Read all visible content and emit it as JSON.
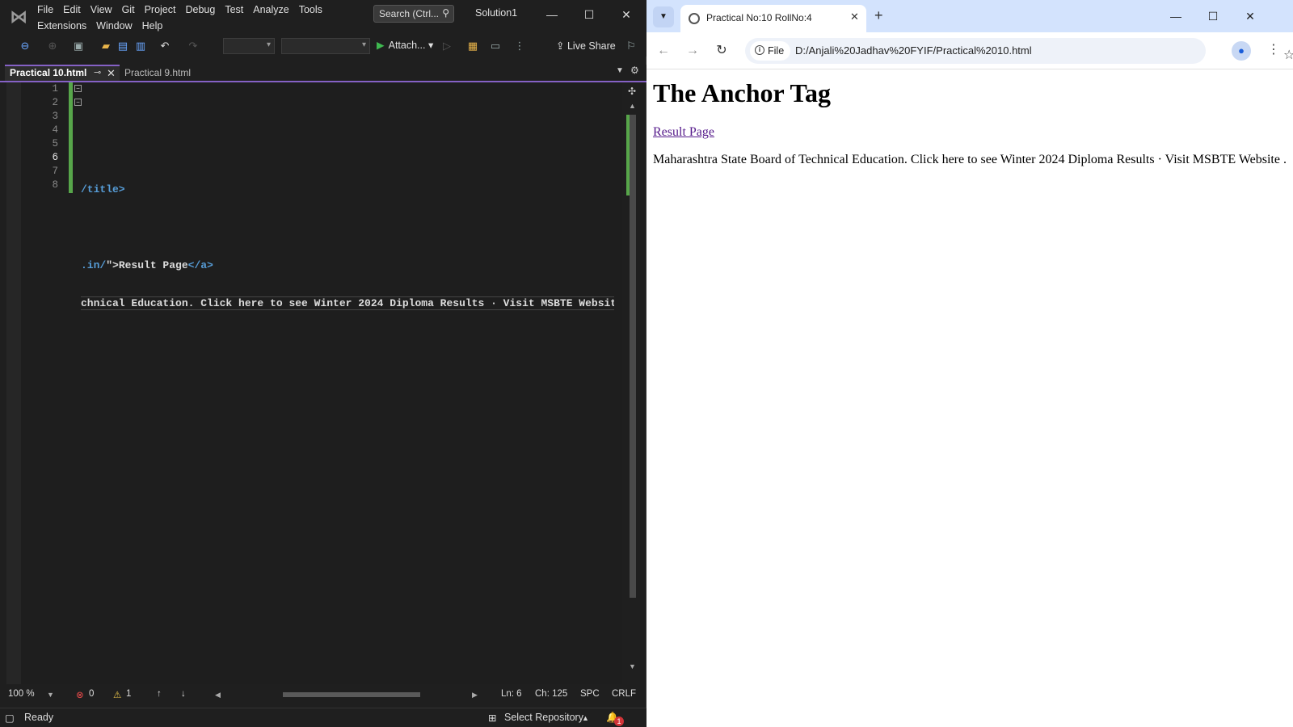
{
  "vs": {
    "menu_row1": [
      "File",
      "Edit",
      "View",
      "Git",
      "Project",
      "Debug",
      "Test",
      "Analyze",
      "Tools"
    ],
    "menu_row2": [
      "Extensions",
      "Window",
      "Help"
    ],
    "search_placeholder": "Search (Ctrl...",
    "solution_name": "Solution1",
    "toolbar": {
      "attach_label": "Attach...",
      "live_share_label": "Live Share"
    },
    "tabs": [
      {
        "label": "Practical 10.html",
        "active": true
      },
      {
        "label": "Practical 9.html",
        "active": false
      }
    ],
    "line_numbers": [
      "1",
      "2",
      "3",
      "4",
      "5",
      "6",
      "7",
      "8"
    ],
    "code_lines": [
      {
        "tag": "",
        "text": ""
      },
      {
        "tag": "",
        "text": ""
      },
      {
        "tag": "/title>",
        "text": ""
      },
      {
        "tag": "",
        "text": ""
      },
      {
        "tag": ".in/",
        "text": "\">Result Page",
        "tag2": "</a>"
      },
      {
        "tag": "",
        "text": "chnical Education. Click here to see Winter 2024 Diploma Results · Visit MSBTE Website ."
      },
      {
        "tag": "",
        "text": ""
      },
      {
        "tag": "",
        "text": ""
      }
    ],
    "status_row": {
      "zoom": "100 %",
      "errors": "0",
      "warnings": "1",
      "line": "Ln: 6",
      "col": "Ch: 125",
      "spacing": "SPC",
      "eol": "CRLF"
    },
    "status_bar": {
      "ready": "Ready",
      "repo": "Select Repository",
      "notifications": "1"
    }
  },
  "chrome": {
    "tab_title": "Practical No:10 RollNo:4",
    "chip_label": "File",
    "url": "D:/Anjali%20Jadhav%20FYIF/Practical%2010.html",
    "page": {
      "heading": "The Anchor Tag",
      "link_text": "Result Page",
      "paragraph": "Maharashtra State Board of Technical Education. Click here to see Winter 2024 Diploma Results · Visit MSBTE Website ."
    }
  },
  "colors": {
    "vs_accent": "#8561c5",
    "change_bar": "#57a64a",
    "html_tag": "#569cd6",
    "chrome_tabstrip": "#d3e3fd",
    "visited_link": "#551a8b"
  }
}
